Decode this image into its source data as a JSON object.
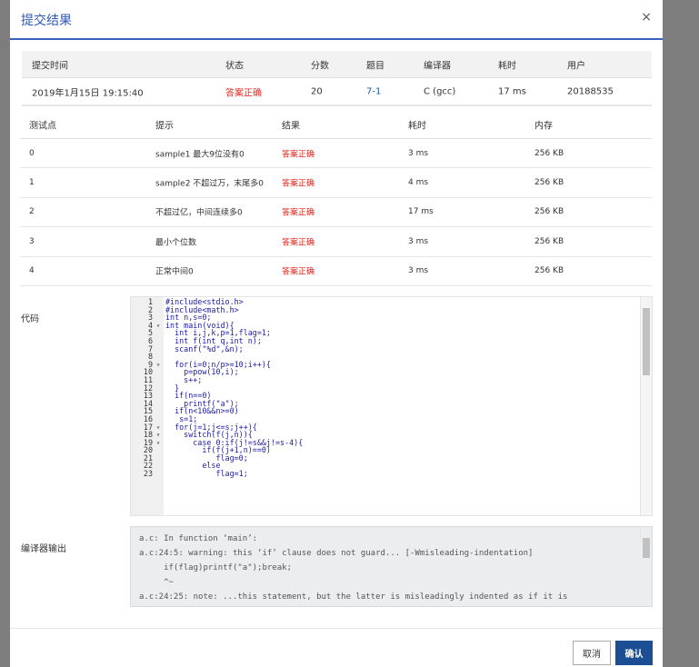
{
  "dialog": {
    "title": "提交结果",
    "close": "×"
  },
  "summary": {
    "headers": [
      "提交时间",
      "状态",
      "分数",
      "题目",
      "编译器",
      "耗时",
      "用户"
    ],
    "row": [
      "2019年1月15日 19:15:40",
      "答案正确",
      "20",
      "7-1",
      "C (gcc)",
      "17 ms",
      "20188535"
    ]
  },
  "tests": {
    "headers": [
      "测试点",
      "提示",
      "结果",
      "耗时",
      "内存"
    ],
    "rows": [
      [
        "0",
        "sample1 最大9位没有0",
        "答案正确",
        "3 ms",
        "256 KB"
      ],
      [
        "1",
        "sample2 不超过万，末尾多0",
        "答案正确",
        "4 ms",
        "256 KB"
      ],
      [
        "2",
        "不超过亿，中间连续多0",
        "答案正确",
        "17 ms",
        "256 KB"
      ],
      [
        "3",
        "最小个位数",
        "答案正确",
        "3 ms",
        "256 KB"
      ],
      [
        "4",
        "正常中间0",
        "答案正确",
        "3 ms",
        "256 KB"
      ]
    ]
  },
  "code_label": "代码",
  "code_lines": [
    "#include<stdio.h>",
    "#include<math.h>",
    "int n,s=0;",
    "int main(void){",
    "  int i,j,k,p=1,flag=1;",
    "  int f(int q,int n);",
    "  scanf(\"%d\",&n);",
    "",
    "  for(i=0;n/p>=10;i++){",
    "    p=pow(10,i);",
    "    s++;",
    "  }",
    "  if(n==0)",
    "    printf(\"a\");",
    "  if(n<10&&n>=0)",
    "   s=1;",
    "  for(j=1;j<=s;j++){",
    "    switch(f(j,n)){",
    "      case 0:if(j!=s&&j!=s-4){",
    "        if(f(j+1,n)==0)",
    "           flag=0;",
    "        else",
    "           flag=1;"
  ],
  "fold_lines": [
    4,
    9,
    17,
    18,
    19
  ],
  "output_label": "编译器输出",
  "output_lines": [
    "a.c: In function ‘main’:",
    "a.c:24:5: warning: this ‘if’ clause does not guard... [-Wmisleading-indentation]",
    "     if(flag)printf(\"a\");break;",
    "     ^~",
    "a.c:24:25: note: ...this statement, but the latter is misleadingly indented as if it is"
  ],
  "buttons": {
    "cancel": "取消",
    "ok": "确认"
  }
}
